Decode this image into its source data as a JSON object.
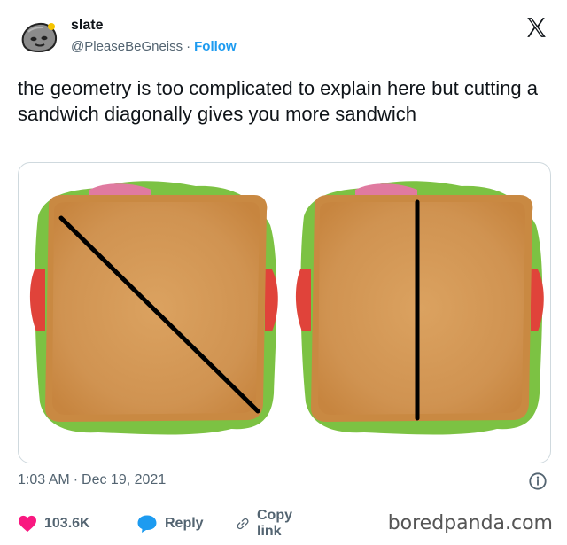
{
  "user": {
    "display_name": "slate",
    "handle": "@PleaseBeGneiss",
    "separator": "·",
    "follow_label": "Follow"
  },
  "tweet": {
    "text": "the geometry is too complicated to explain here but cutting a sandwich diagonally gives you more sandwich"
  },
  "meta": {
    "time": "1:03 AM",
    "separator": "·",
    "date": "Dec 19, 2021"
  },
  "actions": {
    "likes": "103.6K",
    "reply_label": "Reply",
    "copy_link_label": "Copy link"
  },
  "watermark": "boredpanda.com",
  "colors": {
    "accent": "#1d9bf0",
    "like": "#f91880",
    "text": "#0f1419",
    "muted": "#536471"
  },
  "icons": [
    "rock-avatar",
    "x-logo-icon",
    "info-icon",
    "heart-icon",
    "reply-bubble-icon",
    "link-icon"
  ]
}
